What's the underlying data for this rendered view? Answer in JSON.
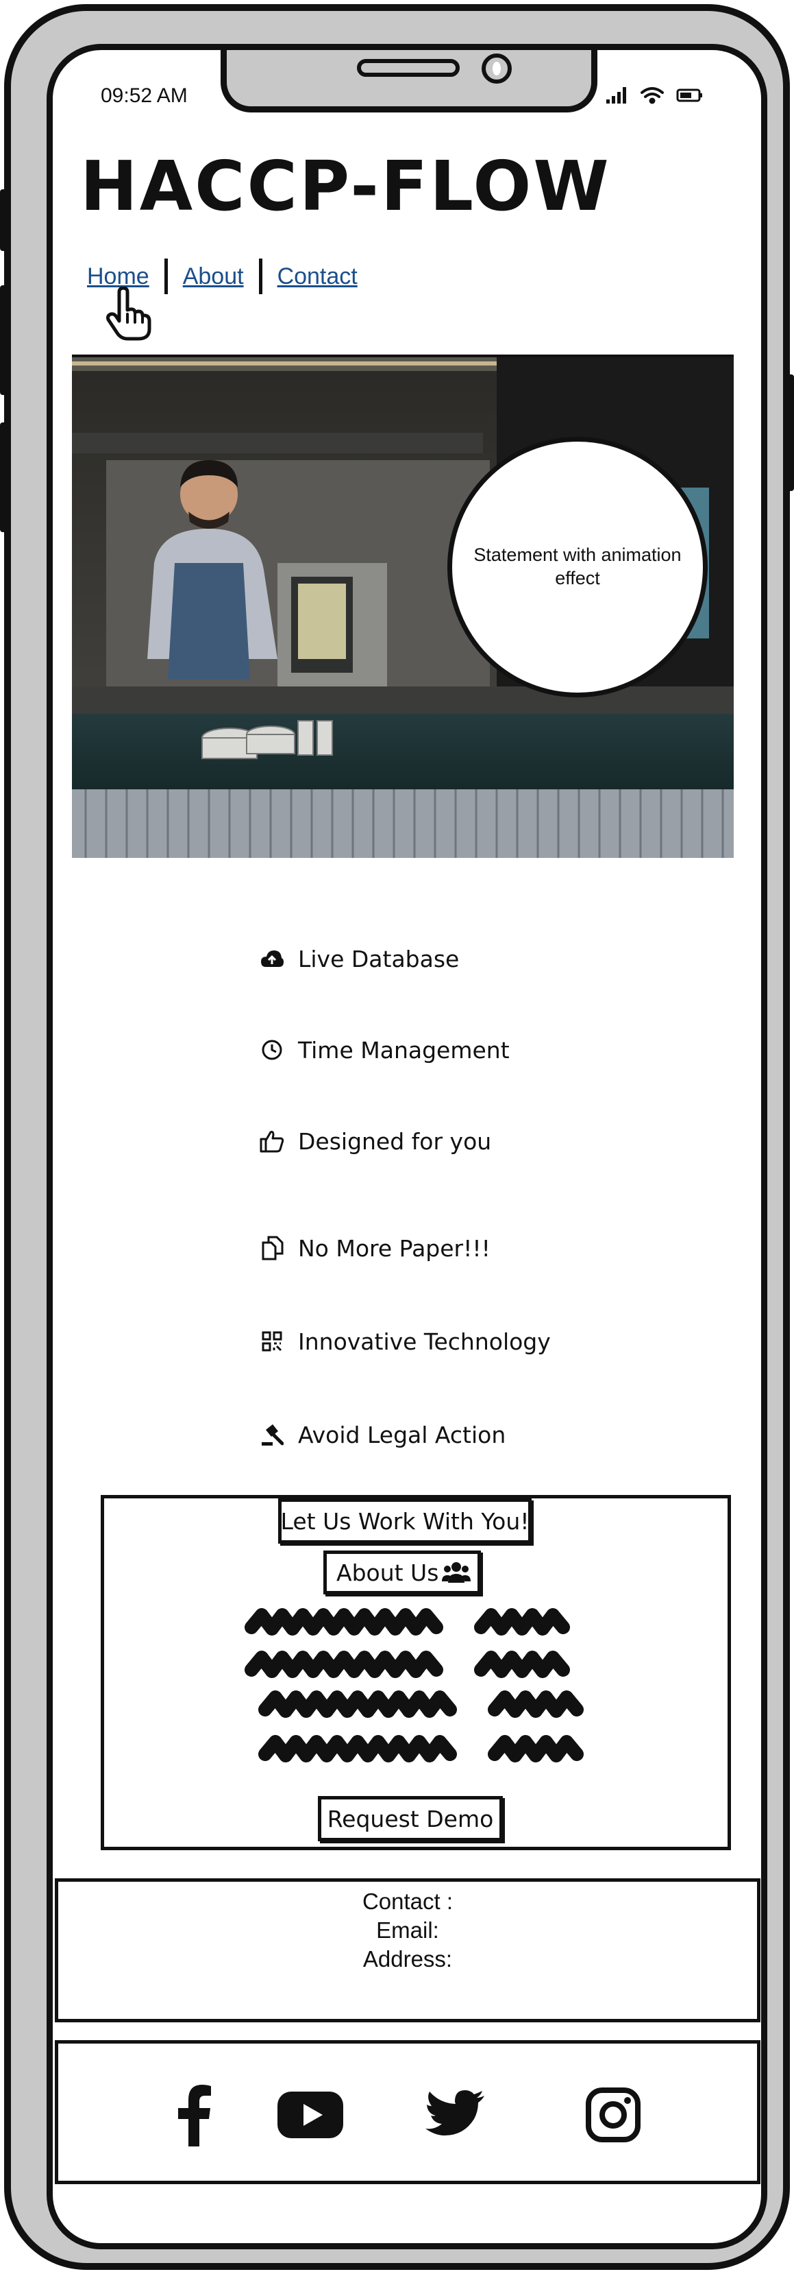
{
  "status_bar": {
    "time": "09:52 AM"
  },
  "app": {
    "title": "HACCP-FLOW"
  },
  "nav": {
    "items": [
      "Home",
      "About",
      "Contact"
    ]
  },
  "hero": {
    "statement": "Statement with animation effect"
  },
  "features": [
    {
      "label": "Live Database",
      "icon": "cloud-upload-icon"
    },
    {
      "label": "Time Management",
      "icon": "clock-icon"
    },
    {
      "label": "Designed for you",
      "icon": "thumbs-up-icon"
    },
    {
      "label": "No More Paper!!!",
      "icon": "documents-icon"
    },
    {
      "label": "Innovative Technology",
      "icon": "qr-code-icon"
    },
    {
      "label": "Avoid Legal Action",
      "icon": "gavel-icon"
    }
  ],
  "work_section": {
    "heading": "Let Us Work With You!",
    "about_label": "About Us",
    "about_icon": "users-icon",
    "demo_label": "Request Demo"
  },
  "contact": {
    "heading": "Contact :",
    "email_label": "Email:",
    "address_label": "Address:"
  },
  "social": [
    "facebook-icon",
    "youtube-icon",
    "twitter-icon",
    "instagram-icon"
  ]
}
